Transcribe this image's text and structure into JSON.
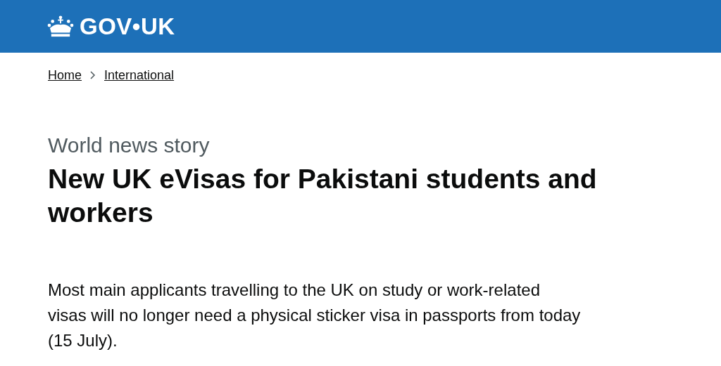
{
  "header": {
    "logo": "GOV•UK"
  },
  "breadcrumbs": [
    {
      "label": "Home"
    },
    {
      "label": "International"
    }
  ],
  "article": {
    "type": "World news story",
    "title": "New UK eVisas for Pakistani students and workers",
    "lead": "Most main applicants travelling to the UK on study or work-related visas will no longer need a physical sticker visa in passports from today (15 July)."
  }
}
